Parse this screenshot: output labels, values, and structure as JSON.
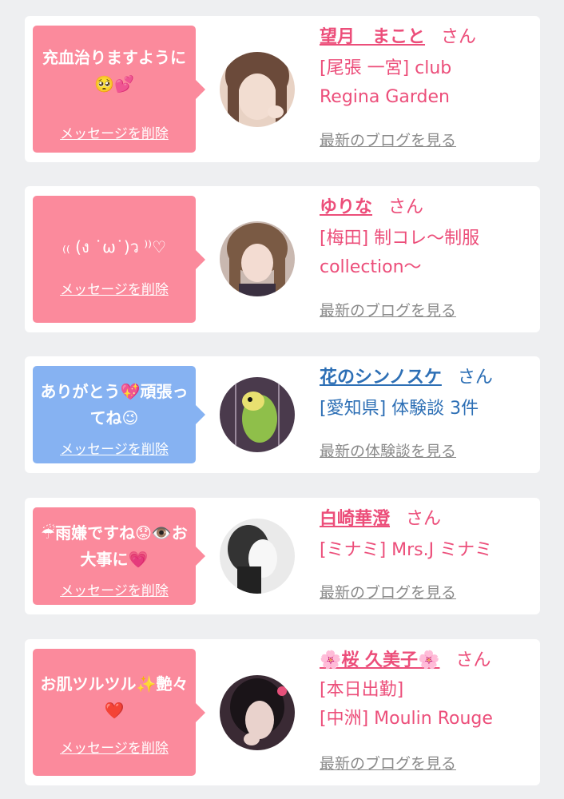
{
  "delete_label": "メッセージを削除",
  "san_label": "さん",
  "cards": [
    {
      "message": "充血治りますように🥺💕",
      "bubble_color": "#fb8a9c",
      "name": "望月　まこと",
      "shop_lines": [
        "[尾張 一宮] club",
        "Regina Garden"
      ],
      "link": "最新のブログを見る"
    },
    {
      "message": "₍₍ (ง ˙ω˙)ว ⁾⁾♡",
      "bubble_color": "#fb8a9c",
      "name": "ゆりな",
      "shop_lines": [
        "[梅田] 制コレ〜制服",
        "collection〜"
      ],
      "link": "最新のブログを見る"
    },
    {
      "message": "ありがとう💖頑張ってね😉",
      "bubble_color": "#86b2f2",
      "name": "花のシンノスケ",
      "shop_lines": [
        "[愛知県] 体験談 3件"
      ],
      "link": "最新の体験談を見る"
    },
    {
      "message": "☔雨嫌ですね😟👁️お大事に💗",
      "bubble_color": "#fb8a9c",
      "name": "白崎華澄",
      "shop_lines": [
        "[ミナミ] Mrs.J ミナミ"
      ],
      "link": "最新のブログを見る"
    },
    {
      "message": "お肌ツルツル✨艶々❤️",
      "bubble_color": "#fb8a9c",
      "name": "🌸桜 久美子🌸",
      "shop_lines": [
        "[本日出勤]",
        "[中洲] Moulin Rouge"
      ],
      "link": "最新のブログを見る"
    }
  ]
}
